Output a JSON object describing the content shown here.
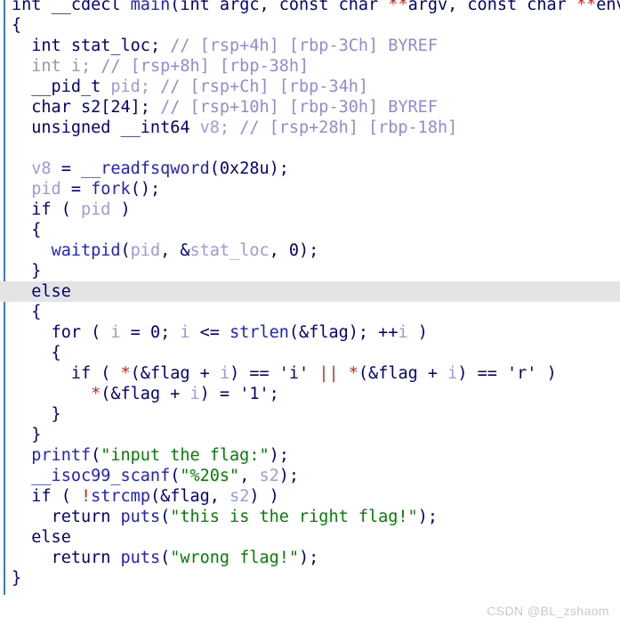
{
  "app": {
    "view_name": "pseudocode-view",
    "background_color": "#ffffff",
    "gutter_color": "#3a7bbf",
    "highlight_color": "#e4e4e4"
  },
  "watermark": {
    "text": "CSDN @BL_zshaom",
    "color": "#c9c9c9"
  },
  "colors": {
    "keyword": "#00007f",
    "function": "#2020d0",
    "local_variable": "#9a9ae0",
    "string": "#008000",
    "comment": "#8c8cdc",
    "dimmed": "#9b9b9b",
    "asterisk": "#cc2020"
  },
  "code": {
    "language": "c",
    "highlighted_line_index": 14,
    "lines": [
      {
        "id": "line-01",
        "text": "int __cdecl main(int argc, const char **argv, const char **envp)",
        "clipped_top": true
      },
      {
        "id": "line-02",
        "text": "{"
      },
      {
        "id": "line-03",
        "text": "  int stat_loc; // [rsp+4h] [rbp-3Ch] BYREF"
      },
      {
        "id": "line-04",
        "text": "  int i; // [rsp+8h] [rbp-38h]"
      },
      {
        "id": "line-05",
        "text": "  __pid_t pid; // [rsp+Ch] [rbp-34h]"
      },
      {
        "id": "line-06",
        "text": "  char s2[24]; // [rsp+10h] [rbp-30h] BYREF"
      },
      {
        "id": "line-07",
        "text": "  unsigned __int64 v8; // [rsp+28h] [rbp-18h]"
      },
      {
        "id": "line-08",
        "text": ""
      },
      {
        "id": "line-09",
        "text": "  v8 = __readfsqword(0x28u);"
      },
      {
        "id": "line-10",
        "text": "  pid = fork();"
      },
      {
        "id": "line-11",
        "text": "  if ( pid )"
      },
      {
        "id": "line-12",
        "text": "  {"
      },
      {
        "id": "line-13",
        "text": "    waitpid(pid, &stat_loc, 0);"
      },
      {
        "id": "line-14",
        "text": "  }"
      },
      {
        "id": "line-15",
        "text": "  else"
      },
      {
        "id": "line-16",
        "text": "  {"
      },
      {
        "id": "line-17",
        "text": "    for ( i = 0; i <= strlen(&flag); ++i )"
      },
      {
        "id": "line-18",
        "text": "    {"
      },
      {
        "id": "line-19",
        "text": "      if ( *(&flag + i) == 'i' || *(&flag + i) == 'r' )"
      },
      {
        "id": "line-20",
        "text": "        *(&flag + i) = '1';"
      },
      {
        "id": "line-21",
        "text": "    }"
      },
      {
        "id": "line-22",
        "text": "  }"
      },
      {
        "id": "line-23",
        "text": "  printf(\"input the flag:\");"
      },
      {
        "id": "line-24",
        "text": "  __isoc99_scanf(\"%20s\", s2);"
      },
      {
        "id": "line-25",
        "text": "  if ( !strcmp(&flag, s2) )"
      },
      {
        "id": "line-26",
        "text": "    return puts(\"this is the right flag!\");"
      },
      {
        "id": "line-27",
        "text": "  else"
      },
      {
        "id": "line-28",
        "text": "    return puts(\"wrong flag!\");"
      },
      {
        "id": "line-29",
        "text": "}"
      }
    ],
    "tokens": {
      "line-01": [
        {
          "t": "int",
          "c": "tok-kw"
        },
        {
          "t": " ",
          "c": "tok-plain"
        },
        {
          "t": "__cdecl",
          "c": "tok-kw"
        },
        {
          "t": " ",
          "c": "tok-plain"
        },
        {
          "t": "main",
          "c": "tok-fn"
        },
        {
          "t": "(",
          "c": "tok-punct"
        },
        {
          "t": "int",
          "c": "tok-kw"
        },
        {
          "t": " argc, ",
          "c": "tok-punct"
        },
        {
          "t": "const",
          "c": "tok-kw"
        },
        {
          "t": " ",
          "c": "tok-plain"
        },
        {
          "t": "char",
          "c": "tok-kw"
        },
        {
          "t": " ",
          "c": "tok-plain"
        },
        {
          "t": "**",
          "c": "tok-star"
        },
        {
          "t": "argv, ",
          "c": "tok-punct"
        },
        {
          "t": "const",
          "c": "tok-kw"
        },
        {
          "t": " ",
          "c": "tok-plain"
        },
        {
          "t": "char",
          "c": "tok-kw"
        },
        {
          "t": " ",
          "c": "tok-plain"
        },
        {
          "t": "**",
          "c": "tok-star"
        },
        {
          "t": "envp)",
          "c": "tok-punct"
        }
      ],
      "line-02": [
        {
          "t": "{",
          "c": "tok-punct"
        }
      ],
      "line-03": [
        {
          "t": "  ",
          "c": "tok-plain"
        },
        {
          "t": "int",
          "c": "tok-kw"
        },
        {
          "t": " stat_loc; ",
          "c": "tok-gvar"
        },
        {
          "t": "// [rsp+4h] [rbp-3Ch] BYREF",
          "c": "tok-cmt"
        }
      ],
      "line-04": [
        {
          "t": "  ",
          "c": "tok-plain"
        },
        {
          "t": "int i; ",
          "c": "tok-dim"
        },
        {
          "t": "// [rsp+8h] [rbp-38h]",
          "c": "tok-cmt"
        }
      ],
      "line-05": [
        {
          "t": "  ",
          "c": "tok-plain"
        },
        {
          "t": "__pid_t",
          "c": "tok-kw"
        },
        {
          "t": " ",
          "c": "tok-plain"
        },
        {
          "t": "pid; ",
          "c": "tok-lvar"
        },
        {
          "t": "// [rsp+Ch] [rbp-34h]",
          "c": "tok-cmt"
        }
      ],
      "line-06": [
        {
          "t": "  ",
          "c": "tok-plain"
        },
        {
          "t": "char",
          "c": "tok-kw"
        },
        {
          "t": " s2[24]; ",
          "c": "tok-gvar"
        },
        {
          "t": "// [rsp+10h] [rbp-30h] BYREF",
          "c": "tok-cmt"
        }
      ],
      "line-07": [
        {
          "t": "  ",
          "c": "tok-plain"
        },
        {
          "t": "unsigned __int64",
          "c": "tok-kw"
        },
        {
          "t": " ",
          "c": "tok-plain"
        },
        {
          "t": "v8; ",
          "c": "tok-lvar"
        },
        {
          "t": "// [rsp+28h] [rbp-18h]",
          "c": "tok-cmt"
        }
      ],
      "line-08": [
        {
          "t": " ",
          "c": "tok-plain"
        }
      ],
      "line-09": [
        {
          "t": "  ",
          "c": "tok-plain"
        },
        {
          "t": "v8",
          "c": "tok-lvar"
        },
        {
          "t": " = ",
          "c": "tok-op"
        },
        {
          "t": "__readfsqword",
          "c": "tok-fn"
        },
        {
          "t": "(",
          "c": "tok-punct"
        },
        {
          "t": "0x28u",
          "c": "tok-num"
        },
        {
          "t": ");",
          "c": "tok-punct"
        }
      ],
      "line-10": [
        {
          "t": "  ",
          "c": "tok-plain"
        },
        {
          "t": "pid",
          "c": "tok-lvar"
        },
        {
          "t": " = ",
          "c": "tok-op"
        },
        {
          "t": "fork",
          "c": "tok-fn"
        },
        {
          "t": "();",
          "c": "tok-punct"
        }
      ],
      "line-11": [
        {
          "t": "  ",
          "c": "tok-plain"
        },
        {
          "t": "if",
          "c": "tok-kw"
        },
        {
          "t": " ( ",
          "c": "tok-punct"
        },
        {
          "t": "pid",
          "c": "tok-lvar"
        },
        {
          "t": " )",
          "c": "tok-punct"
        }
      ],
      "line-12": [
        {
          "t": "  {",
          "c": "tok-punct"
        }
      ],
      "line-13": [
        {
          "t": "    ",
          "c": "tok-plain"
        },
        {
          "t": "waitpid",
          "c": "tok-fn"
        },
        {
          "t": "(",
          "c": "tok-punct"
        },
        {
          "t": "pid",
          "c": "tok-lvar"
        },
        {
          "t": ", &",
          "c": "tok-punct"
        },
        {
          "t": "stat_loc",
          "c": "tok-lvar"
        },
        {
          "t": ", ",
          "c": "tok-punct"
        },
        {
          "t": "0",
          "c": "tok-num"
        },
        {
          "t": ");",
          "c": "tok-punct"
        }
      ],
      "line-14": [
        {
          "t": "  }",
          "c": "tok-punct"
        }
      ],
      "line-15": [
        {
          "t": "  ",
          "c": "tok-plain"
        },
        {
          "t": "else",
          "c": "tok-kw"
        }
      ],
      "line-16": [
        {
          "t": "  {",
          "c": "tok-punct"
        }
      ],
      "line-17": [
        {
          "t": "    ",
          "c": "tok-plain"
        },
        {
          "t": "for",
          "c": "tok-kw"
        },
        {
          "t": " ( ",
          "c": "tok-punct"
        },
        {
          "t": "i",
          "c": "tok-lvar"
        },
        {
          "t": " = ",
          "c": "tok-op"
        },
        {
          "t": "0",
          "c": "tok-num"
        },
        {
          "t": "; ",
          "c": "tok-punct"
        },
        {
          "t": "i",
          "c": "tok-lvar"
        },
        {
          "t": " <= ",
          "c": "tok-op"
        },
        {
          "t": "strlen",
          "c": "tok-fn"
        },
        {
          "t": "(&",
          "c": "tok-punct"
        },
        {
          "t": "flag",
          "c": "tok-gvar"
        },
        {
          "t": "); ++",
          "c": "tok-punct"
        },
        {
          "t": "i",
          "c": "tok-lvar"
        },
        {
          "t": " )",
          "c": "tok-punct"
        }
      ],
      "line-18": [
        {
          "t": "    {",
          "c": "tok-punct"
        }
      ],
      "line-19": [
        {
          "t": "      ",
          "c": "tok-plain"
        },
        {
          "t": "if",
          "c": "tok-kw"
        },
        {
          "t": " ( ",
          "c": "tok-punct"
        },
        {
          "t": "*",
          "c": "tok-star"
        },
        {
          "t": "(&",
          "c": "tok-punct"
        },
        {
          "t": "flag",
          "c": "tok-gvar"
        },
        {
          "t": " + ",
          "c": "tok-op"
        },
        {
          "t": "i",
          "c": "tok-lvar"
        },
        {
          "t": ") == ",
          "c": "tok-op"
        },
        {
          "t": "'i'",
          "c": "tok-char"
        },
        {
          "t": " ",
          "c": "tok-plain"
        },
        {
          "t": "||",
          "c": "tok-pipe"
        },
        {
          "t": " ",
          "c": "tok-plain"
        },
        {
          "t": "*",
          "c": "tok-star"
        },
        {
          "t": "(&",
          "c": "tok-punct"
        },
        {
          "t": "flag",
          "c": "tok-gvar"
        },
        {
          "t": " + ",
          "c": "tok-op"
        },
        {
          "t": "i",
          "c": "tok-lvar"
        },
        {
          "t": ") == ",
          "c": "tok-op"
        },
        {
          "t": "'r'",
          "c": "tok-char"
        },
        {
          "t": " )",
          "c": "tok-punct"
        }
      ],
      "line-20": [
        {
          "t": "        ",
          "c": "tok-plain"
        },
        {
          "t": "*",
          "c": "tok-star"
        },
        {
          "t": "(&",
          "c": "tok-punct"
        },
        {
          "t": "flag",
          "c": "tok-gvar"
        },
        {
          "t": " + ",
          "c": "tok-op"
        },
        {
          "t": "i",
          "c": "tok-lvar"
        },
        {
          "t": ") = ",
          "c": "tok-op"
        },
        {
          "t": "'1'",
          "c": "tok-char"
        },
        {
          "t": ";",
          "c": "tok-punct"
        }
      ],
      "line-21": [
        {
          "t": "    }",
          "c": "tok-punct"
        }
      ],
      "line-22": [
        {
          "t": "  }",
          "c": "tok-punct"
        }
      ],
      "line-23": [
        {
          "t": "  ",
          "c": "tok-plain"
        },
        {
          "t": "printf",
          "c": "tok-fn"
        },
        {
          "t": "(",
          "c": "tok-punct"
        },
        {
          "t": "\"input the flag:\"",
          "c": "tok-str"
        },
        {
          "t": ");",
          "c": "tok-punct"
        }
      ],
      "line-24": [
        {
          "t": "  ",
          "c": "tok-plain"
        },
        {
          "t": "__isoc99_scanf",
          "c": "tok-fn"
        },
        {
          "t": "(",
          "c": "tok-punct"
        },
        {
          "t": "\"%20s\"",
          "c": "tok-str"
        },
        {
          "t": ", ",
          "c": "tok-punct"
        },
        {
          "t": "s2",
          "c": "tok-lvar"
        },
        {
          "t": ");",
          "c": "tok-punct"
        }
      ],
      "line-25": [
        {
          "t": "  ",
          "c": "tok-plain"
        },
        {
          "t": "if",
          "c": "tok-kw"
        },
        {
          "t": " ( ",
          "c": "tok-punct"
        },
        {
          "t": "!",
          "c": "tok-star"
        },
        {
          "t": "strcmp",
          "c": "tok-fn"
        },
        {
          "t": "(&",
          "c": "tok-punct"
        },
        {
          "t": "flag",
          "c": "tok-gvar"
        },
        {
          "t": ", ",
          "c": "tok-punct"
        },
        {
          "t": "s2",
          "c": "tok-lvar"
        },
        {
          "t": ") )",
          "c": "tok-punct"
        }
      ],
      "line-26": [
        {
          "t": "    ",
          "c": "tok-plain"
        },
        {
          "t": "return",
          "c": "tok-kw"
        },
        {
          "t": " ",
          "c": "tok-plain"
        },
        {
          "t": "puts",
          "c": "tok-fn"
        },
        {
          "t": "(",
          "c": "tok-punct"
        },
        {
          "t": "\"this is the right flag!\"",
          "c": "tok-str"
        },
        {
          "t": ");",
          "c": "tok-punct"
        }
      ],
      "line-27": [
        {
          "t": "  ",
          "c": "tok-plain"
        },
        {
          "t": "else",
          "c": "tok-kw"
        }
      ],
      "line-28": [
        {
          "t": "    ",
          "c": "tok-plain"
        },
        {
          "t": "return",
          "c": "tok-kw"
        },
        {
          "t": " ",
          "c": "tok-plain"
        },
        {
          "t": "puts",
          "c": "tok-fn"
        },
        {
          "t": "(",
          "c": "tok-punct"
        },
        {
          "t": "\"wrong flag!\"",
          "c": "tok-str"
        },
        {
          "t": ");",
          "c": "tok-punct"
        }
      ],
      "line-29": [
        {
          "t": "}",
          "c": "tok-punct"
        }
      ]
    }
  }
}
